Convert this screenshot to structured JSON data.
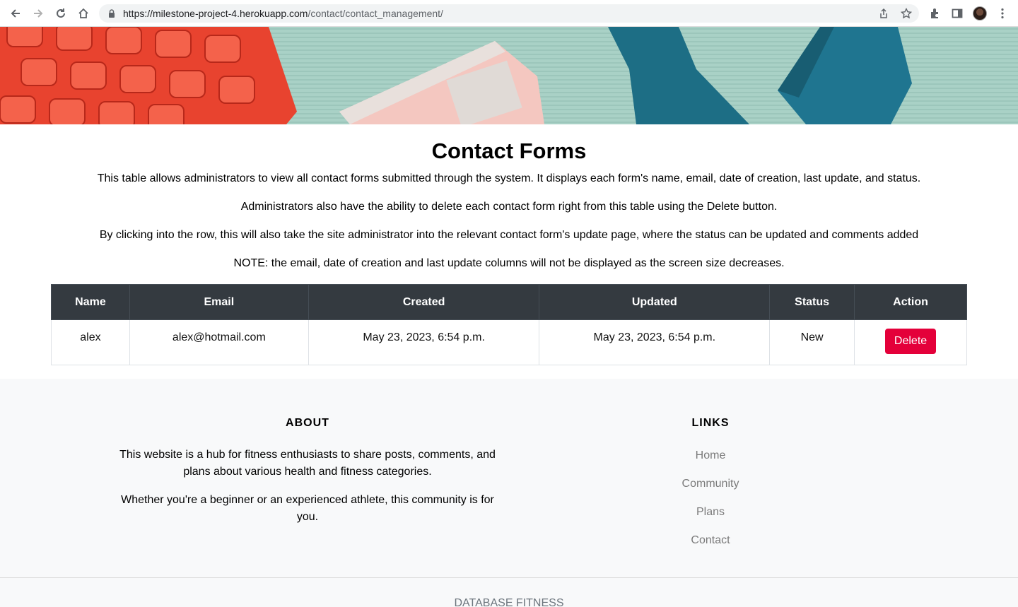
{
  "browser": {
    "url_host": "https://milestone-project-4.herokuapp.com",
    "url_path": "/contact/contact_management/"
  },
  "page": {
    "title": "Contact Forms",
    "paragraphs": [
      "This table allows administrators to view all contact forms submitted through the system. It displays each form's name, email, date of creation, last update, and status.",
      "Administrators also have the ability to delete each contact form right from this table using the Delete button.",
      "By clicking into the row, this will also take the site administrator into the relevant contact form's update page, where the status can be updated and comments added",
      "NOTE: the email, date of creation and last update columns will not be displayed as the screen size decreases."
    ]
  },
  "table": {
    "headers": [
      "Name",
      "Email",
      "Created",
      "Updated",
      "Status",
      "Action"
    ],
    "rows": [
      {
        "name": "alex",
        "email": "alex@hotmail.com",
        "created": "May 23, 2023, 6:54 p.m.",
        "updated": "May 23, 2023, 6:54 p.m.",
        "status": "New",
        "action_label": "Delete"
      }
    ]
  },
  "footer": {
    "about_heading": "ABOUT",
    "about_paragraphs": [
      "This website is a hub for fitness enthusiasts to share posts, comments, and plans about various health and fitness categories.",
      "Whether you're a beginner or an experienced athlete, this community is for you."
    ],
    "links_heading": "LINKS",
    "links": [
      "Home",
      "Community",
      "Plans",
      "Contact"
    ],
    "copyright": "DATABASE FITNESS"
  },
  "colors": {
    "table_header_bg": "#343a40",
    "delete_button": "#e4003a",
    "footer_bg": "#f8f9fa"
  }
}
